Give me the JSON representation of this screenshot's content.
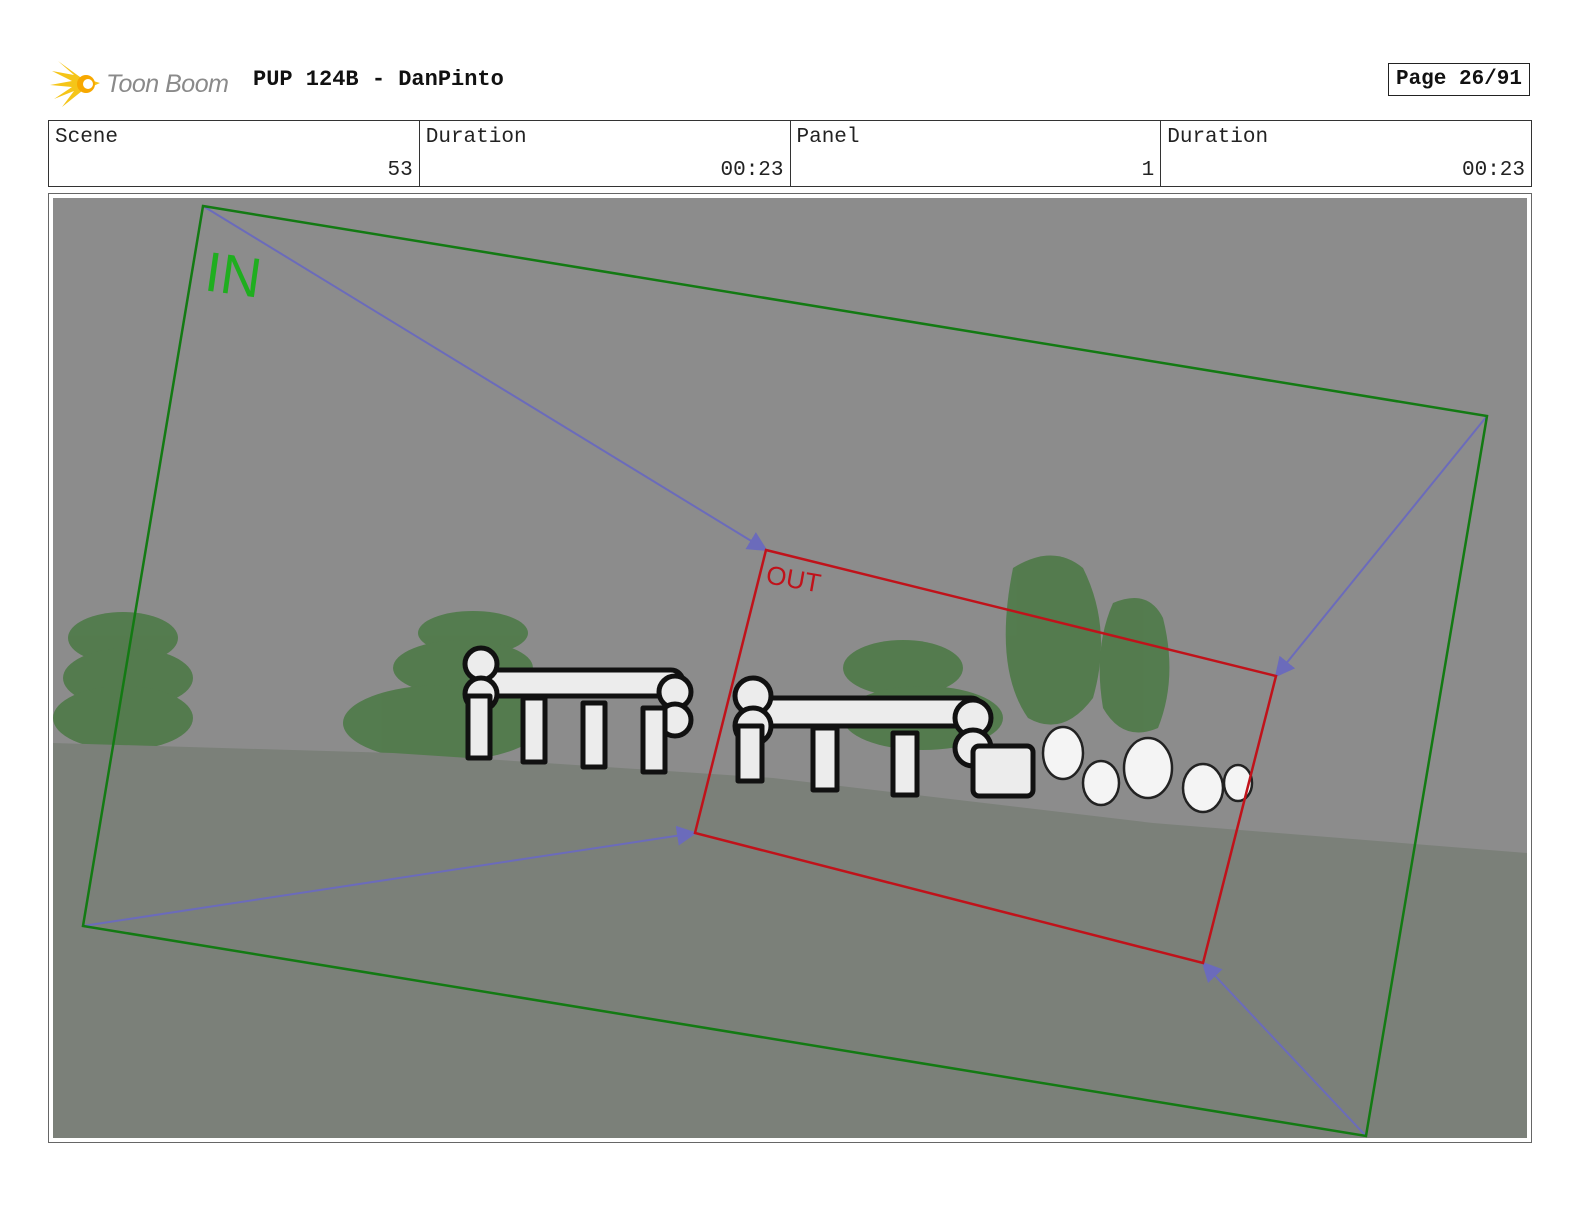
{
  "header": {
    "logo_text": "Toon Boom",
    "title": "PUP 124B - DanPinto",
    "page": "Page 26/91"
  },
  "info": {
    "scene_label": "Scene",
    "scene_value": "53",
    "scene_duration_label": "Duration",
    "scene_duration_value": "00:23",
    "panel_label": "Panel",
    "panel_value": "1",
    "panel_duration_label": "Duration",
    "panel_duration_value": "00:23"
  },
  "panel": {
    "in_label": "IN",
    "out_label": "OUT",
    "in_frame_color": "#137a13",
    "out_frame_color": "#c0121a",
    "arrow_color": "#6b6bbb",
    "background_color": "#8c8c8c",
    "ground_color": "#7b8079",
    "tree_color": "#4e7a48"
  }
}
